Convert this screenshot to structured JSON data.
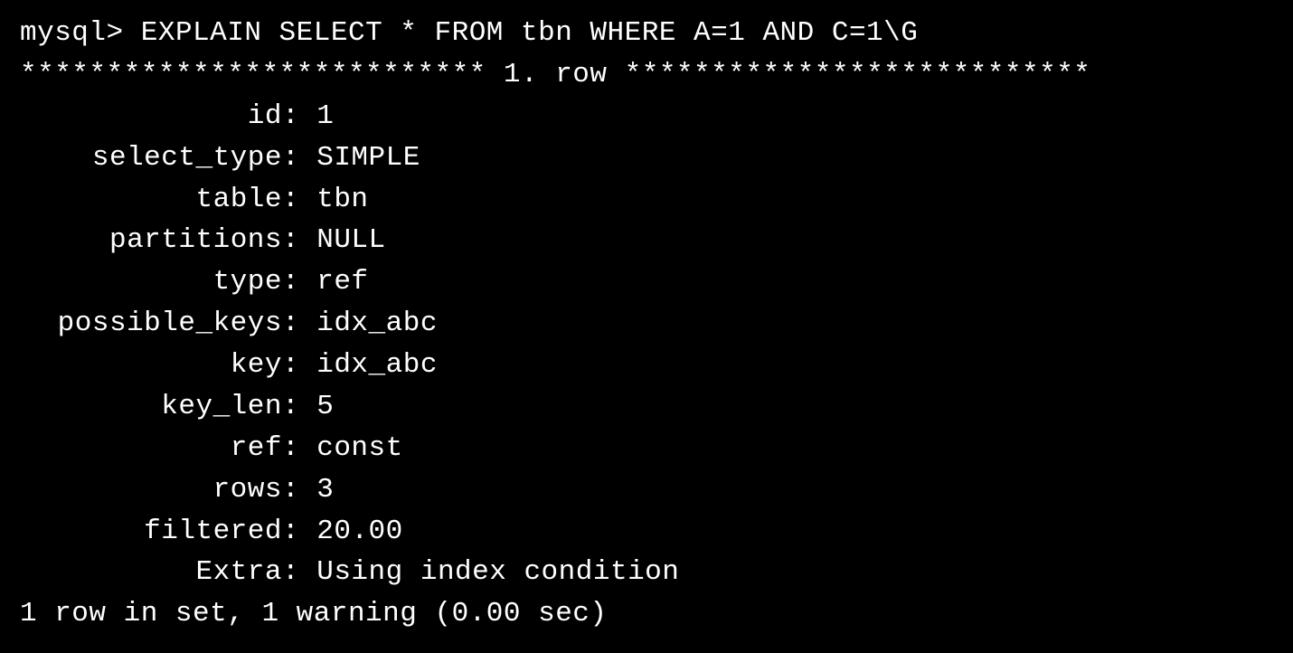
{
  "prompt": "mysql> ",
  "command": "EXPLAIN SELECT * FROM tbn WHERE A=1 AND C=1\\G",
  "separator": {
    "left_stars": "***************************",
    "marker": " 1. row ",
    "right_stars": "***************************"
  },
  "rows": [
    {
      "label": "id",
      "value": "1"
    },
    {
      "label": "select_type",
      "value": "SIMPLE"
    },
    {
      "label": "table",
      "value": "tbn"
    },
    {
      "label": "partitions",
      "value": "NULL"
    },
    {
      "label": "type",
      "value": "ref"
    },
    {
      "label": "possible_keys",
      "value": "idx_abc"
    },
    {
      "label": "key",
      "value": "idx_abc"
    },
    {
      "label": "key_len",
      "value": "5"
    },
    {
      "label": "ref",
      "value": "const"
    },
    {
      "label": "rows",
      "value": "3"
    },
    {
      "label": "filtered",
      "value": "20.00"
    },
    {
      "label": "Extra",
      "value": "Using index condition"
    }
  ],
  "footer": "1 row in set, 1 warning (0.00 sec)"
}
